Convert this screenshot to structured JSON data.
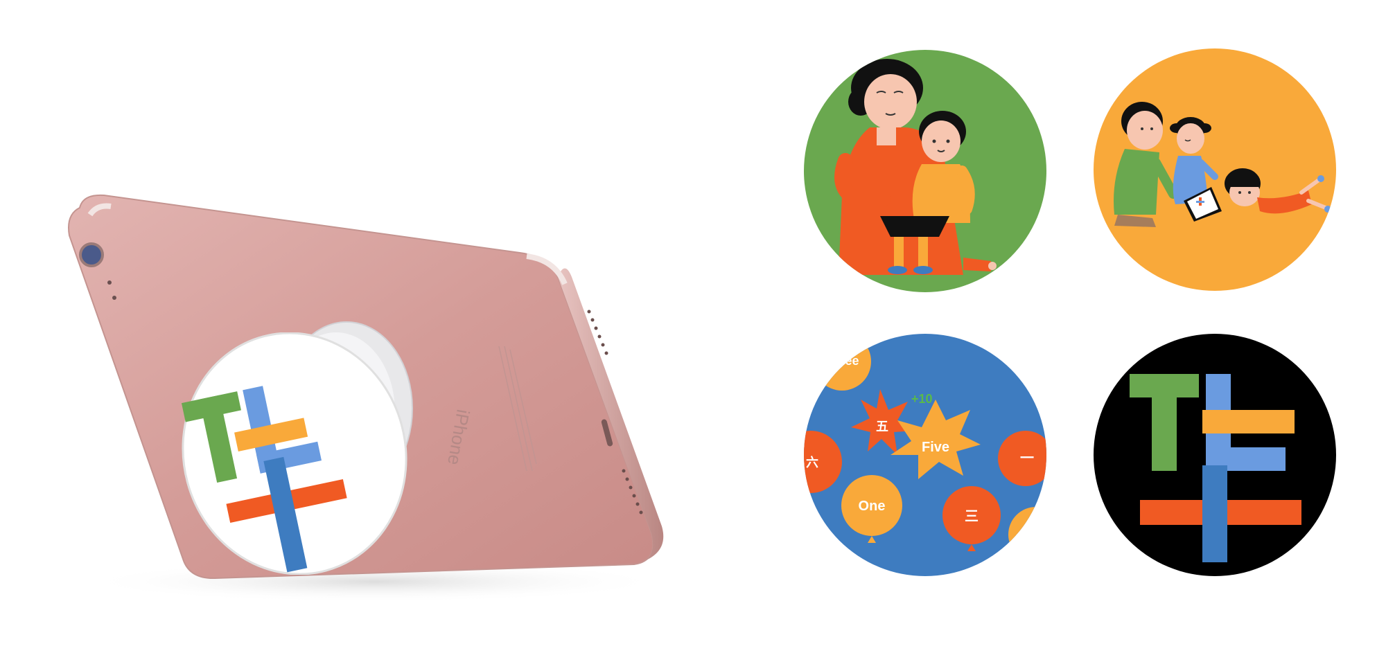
{
  "colors": {
    "brand_green": "#6aa84f",
    "brand_orange": "#f9a93a",
    "brand_red": "#f05a23",
    "brand_blue": "#3e7cc0",
    "logo_light_blue": "#6a9be0",
    "logo_bg_black": "#000000",
    "phone_rose_gold": "#d9a6a2",
    "score_green": "#5aba4a"
  },
  "product": {
    "phone_engraving": "iPhone",
    "grip_logo_letters": "TLT"
  },
  "designs": [
    {
      "name": "family-reading",
      "background": "#6aa84f"
    },
    {
      "name": "kids-playing",
      "background": "#f9a93a"
    },
    {
      "name": "number-balloons",
      "background": "#3e7cc0"
    },
    {
      "name": "tlt-logo",
      "background": "#000000"
    }
  ],
  "balloons": {
    "three": "Three",
    "five_cn": "五",
    "score": "+10",
    "five": "Five",
    "six_cn": "六",
    "one_cn": "一",
    "one": "One",
    "three_cn": "三"
  }
}
